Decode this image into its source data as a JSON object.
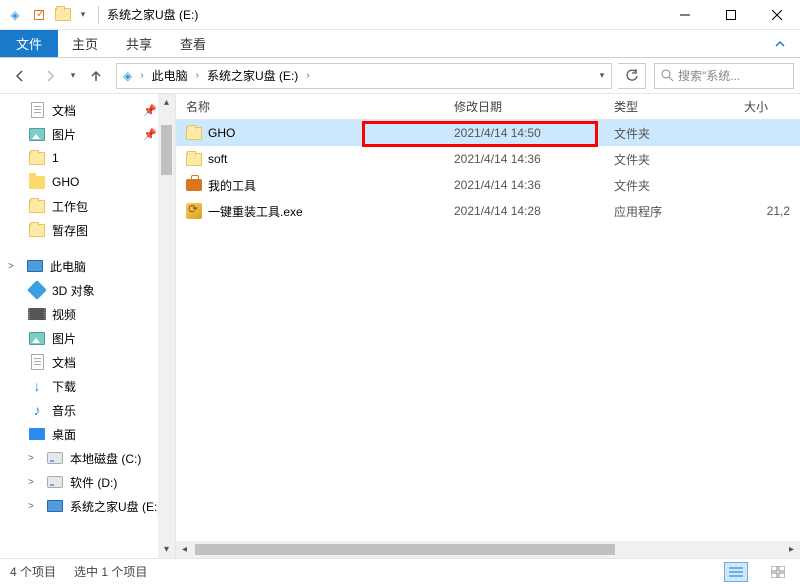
{
  "titlebar": {
    "title": "系统之家U盘 (E:)"
  },
  "ribbon": {
    "file": "文件",
    "tabs": [
      "主页",
      "共享",
      "查看"
    ]
  },
  "nav": {
    "breadcrumb": {
      "root": "此电脑",
      "current": "系统之家U盘 (E:)"
    },
    "search_placeholder": "搜索\"系统..."
  },
  "sidebar": {
    "items": [
      {
        "label": "文档",
        "icon": "doc",
        "indent": 1,
        "pinned": true
      },
      {
        "label": "图片",
        "icon": "pic",
        "indent": 1,
        "pinned": true
      },
      {
        "label": "1",
        "icon": "folder",
        "indent": 1
      },
      {
        "label": "GHO",
        "icon": "folder-open",
        "indent": 1
      },
      {
        "label": "工作包",
        "icon": "folder",
        "indent": 1
      },
      {
        "label": "暂存图",
        "icon": "folder",
        "indent": 1
      },
      {
        "label": "此电脑",
        "icon": "pc",
        "indent": 0,
        "spacer_before": true,
        "caret": ">"
      },
      {
        "label": "3D 对象",
        "icon": "obj3d",
        "indent": 1
      },
      {
        "label": "视频",
        "icon": "vid",
        "indent": 1
      },
      {
        "label": "图片",
        "icon": "pic",
        "indent": 1
      },
      {
        "label": "文档",
        "icon": "doc",
        "indent": 1
      },
      {
        "label": "下载",
        "icon": "dl",
        "indent": 1
      },
      {
        "label": "音乐",
        "icon": "music",
        "indent": 1
      },
      {
        "label": "桌面",
        "icon": "desktop",
        "indent": 1
      },
      {
        "label": "本地磁盘 (C:)",
        "icon": "disk",
        "indent": 1,
        "caret": ">"
      },
      {
        "label": "软件 (D:)",
        "icon": "disk",
        "indent": 1,
        "caret": ">"
      },
      {
        "label": "系统之家U盘 (E:)",
        "icon": "pc",
        "indent": 1,
        "caret": ">"
      }
    ]
  },
  "columns": {
    "name": "名称",
    "date": "修改日期",
    "type": "类型",
    "size": "大小"
  },
  "files": [
    {
      "name": "GHO",
      "date": "2021/4/14 14:50",
      "type": "文件夹",
      "size": "",
      "icon": "folder",
      "selected": true,
      "highlight": true
    },
    {
      "name": "soft",
      "date": "2021/4/14 14:36",
      "type": "文件夹",
      "size": "",
      "icon": "folder"
    },
    {
      "name": "我的工具",
      "date": "2021/4/14 14:36",
      "type": "文件夹",
      "size": "",
      "icon": "toolbox"
    },
    {
      "name": "一键重装工具.exe",
      "date": "2021/4/14 14:28",
      "type": "应用程序",
      "size": "21,2",
      "icon": "exe"
    }
  ],
  "status": {
    "count": "4 个项目",
    "selected": "选中 1 个项目"
  }
}
